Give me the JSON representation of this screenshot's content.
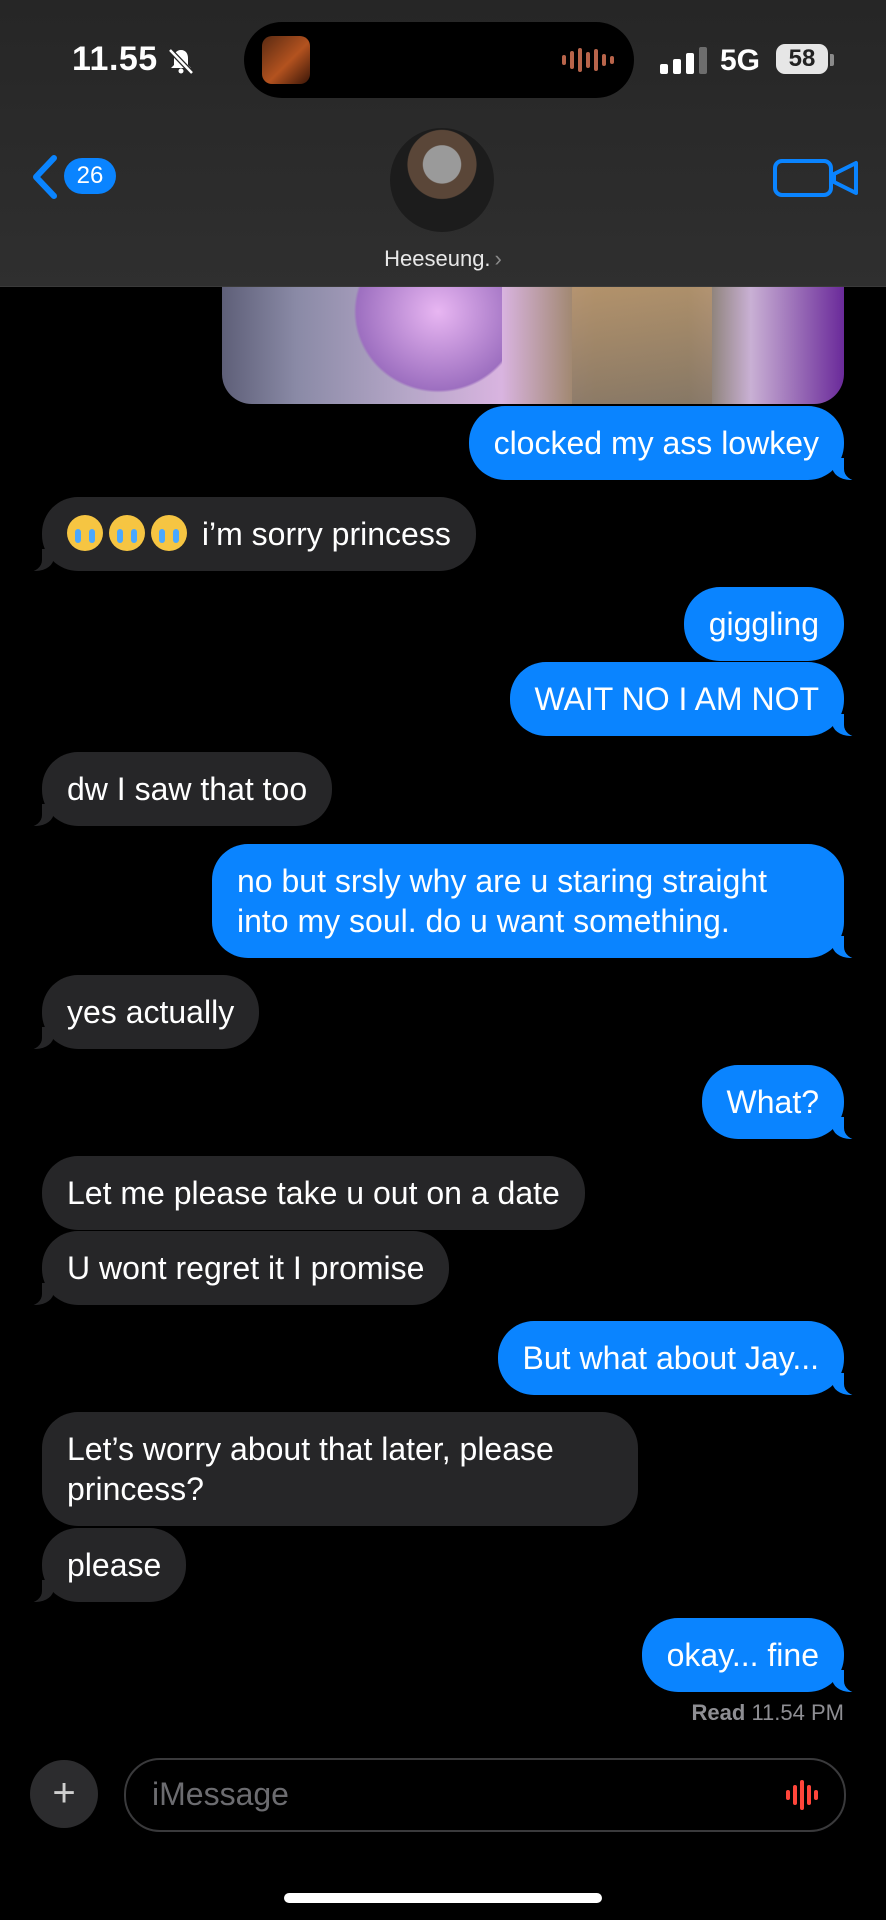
{
  "status_bar": {
    "time": "11.55",
    "network": "5G",
    "battery": "58"
  },
  "header": {
    "back_count": "26",
    "contact_name": "Heeseung."
  },
  "messages": [
    {
      "from": "sent",
      "text": "clocked my ass lowkey"
    },
    {
      "from": "received",
      "emoji_count": 3,
      "text": "i’m sorry princess"
    },
    {
      "from": "sent",
      "text": "giggling"
    },
    {
      "from": "sent",
      "text": "WAIT NO I AM NOT"
    },
    {
      "from": "received",
      "text": "dw I saw that too"
    },
    {
      "from": "sent",
      "text": "no but srsly why are u staring straight into my soul. do u want something."
    },
    {
      "from": "received",
      "text": "yes actually"
    },
    {
      "from": "sent",
      "text": "What?"
    },
    {
      "from": "received",
      "text": "Let me please take u out on a date"
    },
    {
      "from": "received",
      "text": "U wont regret it I promise"
    },
    {
      "from": "sent",
      "text": "But what about Jay..."
    },
    {
      "from": "received",
      "text": "Let’s worry about that later, please princess?"
    },
    {
      "from": "received",
      "text": "please"
    },
    {
      "from": "sent",
      "text": "okay... fine"
    }
  ],
  "read_receipt": {
    "label": "Read",
    "time": "11.54 PM"
  },
  "input": {
    "placeholder": "iMessage"
  },
  "colors": {
    "sent_bubble": "#0a84ff",
    "received_bubble": "#262628",
    "accent": "#0a84ff"
  }
}
